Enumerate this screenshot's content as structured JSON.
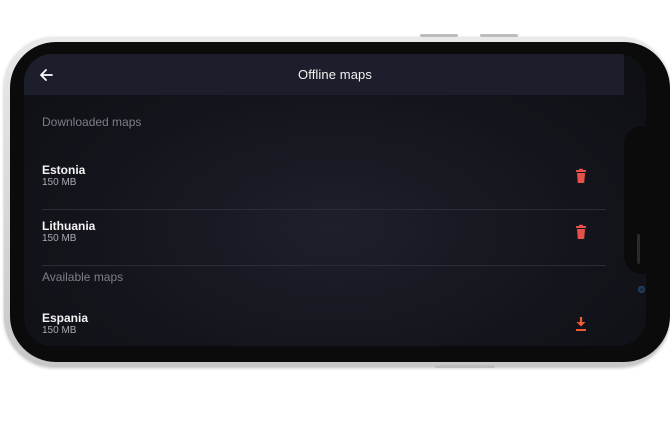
{
  "header": {
    "title": "Offline maps",
    "back_icon": "arrow-left-icon"
  },
  "sections": {
    "downloaded": {
      "title": "Downloaded maps",
      "items": [
        {
          "name": "Estonia",
          "size": "150 MB",
          "action_icon": "trash-icon"
        },
        {
          "name": "Lithuania",
          "size": "150 MB",
          "action_icon": "trash-icon"
        }
      ]
    },
    "available": {
      "title": "Available maps",
      "items": [
        {
          "name": "Espania",
          "size": "150 MB",
          "action_icon": "download-icon"
        }
      ]
    }
  },
  "colors": {
    "appbar": "#1c1f2b",
    "screen_bg": "#14151c",
    "delete_accent": "#e55249",
    "download_accent": "#f05a2e",
    "section_header": "#7c7f89",
    "primary_text": "#f4f4f4",
    "secondary_text": "#a9abb3"
  }
}
